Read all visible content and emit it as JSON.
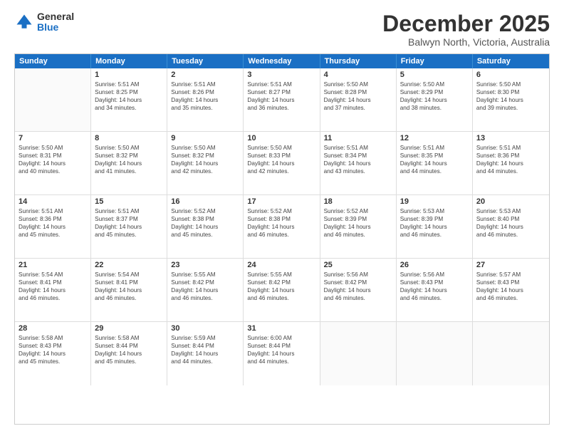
{
  "logo": {
    "general": "General",
    "blue": "Blue"
  },
  "header": {
    "month": "December 2025",
    "location": "Balwyn North, Victoria, Australia"
  },
  "days": [
    "Sunday",
    "Monday",
    "Tuesday",
    "Wednesday",
    "Thursday",
    "Friday",
    "Saturday"
  ],
  "weeks": [
    [
      {
        "day": "",
        "lines": []
      },
      {
        "day": "1",
        "lines": [
          "Sunrise: 5:51 AM",
          "Sunset: 8:25 PM",
          "Daylight: 14 hours",
          "and 34 minutes."
        ]
      },
      {
        "day": "2",
        "lines": [
          "Sunrise: 5:51 AM",
          "Sunset: 8:26 PM",
          "Daylight: 14 hours",
          "and 35 minutes."
        ]
      },
      {
        "day": "3",
        "lines": [
          "Sunrise: 5:51 AM",
          "Sunset: 8:27 PM",
          "Daylight: 14 hours",
          "and 36 minutes."
        ]
      },
      {
        "day": "4",
        "lines": [
          "Sunrise: 5:50 AM",
          "Sunset: 8:28 PM",
          "Daylight: 14 hours",
          "and 37 minutes."
        ]
      },
      {
        "day": "5",
        "lines": [
          "Sunrise: 5:50 AM",
          "Sunset: 8:29 PM",
          "Daylight: 14 hours",
          "and 38 minutes."
        ]
      },
      {
        "day": "6",
        "lines": [
          "Sunrise: 5:50 AM",
          "Sunset: 8:30 PM",
          "Daylight: 14 hours",
          "and 39 minutes."
        ]
      }
    ],
    [
      {
        "day": "7",
        "lines": [
          "Sunrise: 5:50 AM",
          "Sunset: 8:31 PM",
          "Daylight: 14 hours",
          "and 40 minutes."
        ]
      },
      {
        "day": "8",
        "lines": [
          "Sunrise: 5:50 AM",
          "Sunset: 8:32 PM",
          "Daylight: 14 hours",
          "and 41 minutes."
        ]
      },
      {
        "day": "9",
        "lines": [
          "Sunrise: 5:50 AM",
          "Sunset: 8:32 PM",
          "Daylight: 14 hours",
          "and 42 minutes."
        ]
      },
      {
        "day": "10",
        "lines": [
          "Sunrise: 5:50 AM",
          "Sunset: 8:33 PM",
          "Daylight: 14 hours",
          "and 42 minutes."
        ]
      },
      {
        "day": "11",
        "lines": [
          "Sunrise: 5:51 AM",
          "Sunset: 8:34 PM",
          "Daylight: 14 hours",
          "and 43 minutes."
        ]
      },
      {
        "day": "12",
        "lines": [
          "Sunrise: 5:51 AM",
          "Sunset: 8:35 PM",
          "Daylight: 14 hours",
          "and 44 minutes."
        ]
      },
      {
        "day": "13",
        "lines": [
          "Sunrise: 5:51 AM",
          "Sunset: 8:36 PM",
          "Daylight: 14 hours",
          "and 44 minutes."
        ]
      }
    ],
    [
      {
        "day": "14",
        "lines": [
          "Sunrise: 5:51 AM",
          "Sunset: 8:36 PM",
          "Daylight: 14 hours",
          "and 45 minutes."
        ]
      },
      {
        "day": "15",
        "lines": [
          "Sunrise: 5:51 AM",
          "Sunset: 8:37 PM",
          "Daylight: 14 hours",
          "and 45 minutes."
        ]
      },
      {
        "day": "16",
        "lines": [
          "Sunrise: 5:52 AM",
          "Sunset: 8:38 PM",
          "Daylight: 14 hours",
          "and 45 minutes."
        ]
      },
      {
        "day": "17",
        "lines": [
          "Sunrise: 5:52 AM",
          "Sunset: 8:38 PM",
          "Daylight: 14 hours",
          "and 46 minutes."
        ]
      },
      {
        "day": "18",
        "lines": [
          "Sunrise: 5:52 AM",
          "Sunset: 8:39 PM",
          "Daylight: 14 hours",
          "and 46 minutes."
        ]
      },
      {
        "day": "19",
        "lines": [
          "Sunrise: 5:53 AM",
          "Sunset: 8:39 PM",
          "Daylight: 14 hours",
          "and 46 minutes."
        ]
      },
      {
        "day": "20",
        "lines": [
          "Sunrise: 5:53 AM",
          "Sunset: 8:40 PM",
          "Daylight: 14 hours",
          "and 46 minutes."
        ]
      }
    ],
    [
      {
        "day": "21",
        "lines": [
          "Sunrise: 5:54 AM",
          "Sunset: 8:41 PM",
          "Daylight: 14 hours",
          "and 46 minutes."
        ]
      },
      {
        "day": "22",
        "lines": [
          "Sunrise: 5:54 AM",
          "Sunset: 8:41 PM",
          "Daylight: 14 hours",
          "and 46 minutes."
        ]
      },
      {
        "day": "23",
        "lines": [
          "Sunrise: 5:55 AM",
          "Sunset: 8:42 PM",
          "Daylight: 14 hours",
          "and 46 minutes."
        ]
      },
      {
        "day": "24",
        "lines": [
          "Sunrise: 5:55 AM",
          "Sunset: 8:42 PM",
          "Daylight: 14 hours",
          "and 46 minutes."
        ]
      },
      {
        "day": "25",
        "lines": [
          "Sunrise: 5:56 AM",
          "Sunset: 8:42 PM",
          "Daylight: 14 hours",
          "and 46 minutes."
        ]
      },
      {
        "day": "26",
        "lines": [
          "Sunrise: 5:56 AM",
          "Sunset: 8:43 PM",
          "Daylight: 14 hours",
          "and 46 minutes."
        ]
      },
      {
        "day": "27",
        "lines": [
          "Sunrise: 5:57 AM",
          "Sunset: 8:43 PM",
          "Daylight: 14 hours",
          "and 46 minutes."
        ]
      }
    ],
    [
      {
        "day": "28",
        "lines": [
          "Sunrise: 5:58 AM",
          "Sunset: 8:43 PM",
          "Daylight: 14 hours",
          "and 45 minutes."
        ]
      },
      {
        "day": "29",
        "lines": [
          "Sunrise: 5:58 AM",
          "Sunset: 8:44 PM",
          "Daylight: 14 hours",
          "and 45 minutes."
        ]
      },
      {
        "day": "30",
        "lines": [
          "Sunrise: 5:59 AM",
          "Sunset: 8:44 PM",
          "Daylight: 14 hours",
          "and 44 minutes."
        ]
      },
      {
        "day": "31",
        "lines": [
          "Sunrise: 6:00 AM",
          "Sunset: 8:44 PM",
          "Daylight: 14 hours",
          "and 44 minutes."
        ]
      },
      {
        "day": "",
        "lines": []
      },
      {
        "day": "",
        "lines": []
      },
      {
        "day": "",
        "lines": []
      }
    ]
  ]
}
